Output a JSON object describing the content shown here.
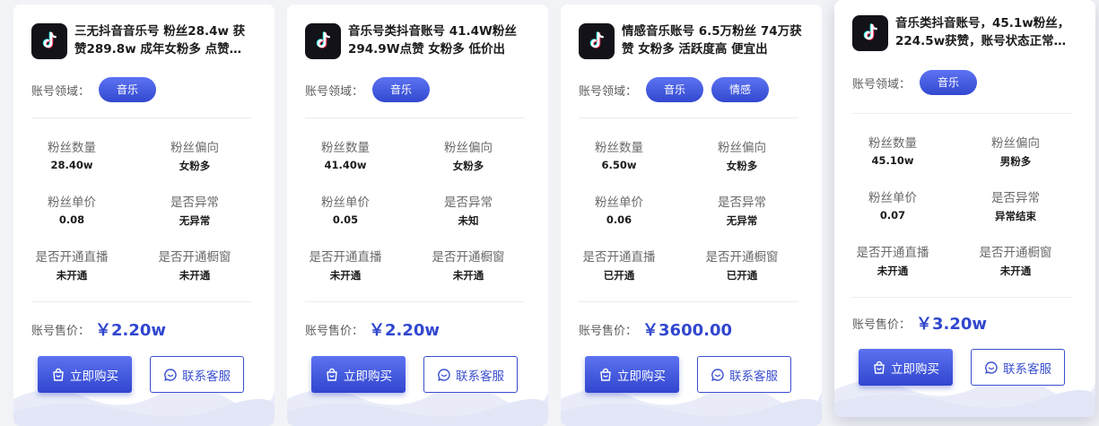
{
  "labels": {
    "domain": "账号领域：",
    "fans_count": "粉丝数量",
    "fans_bias": "粉丝偏向",
    "fans_unit_price": "粉丝单价",
    "abnormal": "是否异常",
    "live": "是否开通直播",
    "showcase": "是否开通橱窗",
    "price": "账号售价：",
    "buy_button": "立即购买",
    "contact_button": "联系客服"
  },
  "colors": {
    "accent": "#3147cf",
    "tag_bg": "#4a5fe2"
  },
  "icons": {
    "logo": "tiktok-logo-icon",
    "buy": "shopping-bag-icon",
    "contact": "chat-icon"
  },
  "cards": [
    {
      "title": "三无抖音音乐号 粉丝28.4w 获赞289.8w 成年女粉多 点赞…",
      "tags": [
        "音乐"
      ],
      "fans_count": "28.40w",
      "fans_bias": "女粉多",
      "fans_unit_price": "0.08",
      "abnormal": "无异常",
      "live": "未开通",
      "showcase": "未开通",
      "price": "￥2.20w"
    },
    {
      "title": "音乐号类抖音账号 41.4W粉丝 294.9W点赞 女粉多 低价出",
      "tags": [
        "音乐"
      ],
      "fans_count": "41.40w",
      "fans_bias": "女粉多",
      "fans_unit_price": "0.05",
      "abnormal": "未知",
      "live": "未开通",
      "showcase": "未开通",
      "price": "￥2.20w"
    },
    {
      "title": "情感音乐账号 6.5万粉丝 74万获赞 女粉多 活跃度高 便宜出",
      "tags": [
        "音乐",
        "情感"
      ],
      "fans_count": "6.50w",
      "fans_bias": "女粉多",
      "fans_unit_price": "0.06",
      "abnormal": "无异常",
      "live": "已开通",
      "showcase": "已开通",
      "price": "￥3600.00"
    },
    {
      "title": "音乐类抖音账号，45.1w粉丝，224.5w获赞，账号状态正常…",
      "tags": [
        "音乐"
      ],
      "fans_count": "45.10w",
      "fans_bias": "男粉多",
      "fans_unit_price": "0.07",
      "abnormal": "异常结束",
      "live": "未开通",
      "showcase": "未开通",
      "price": "￥3.20w"
    }
  ]
}
